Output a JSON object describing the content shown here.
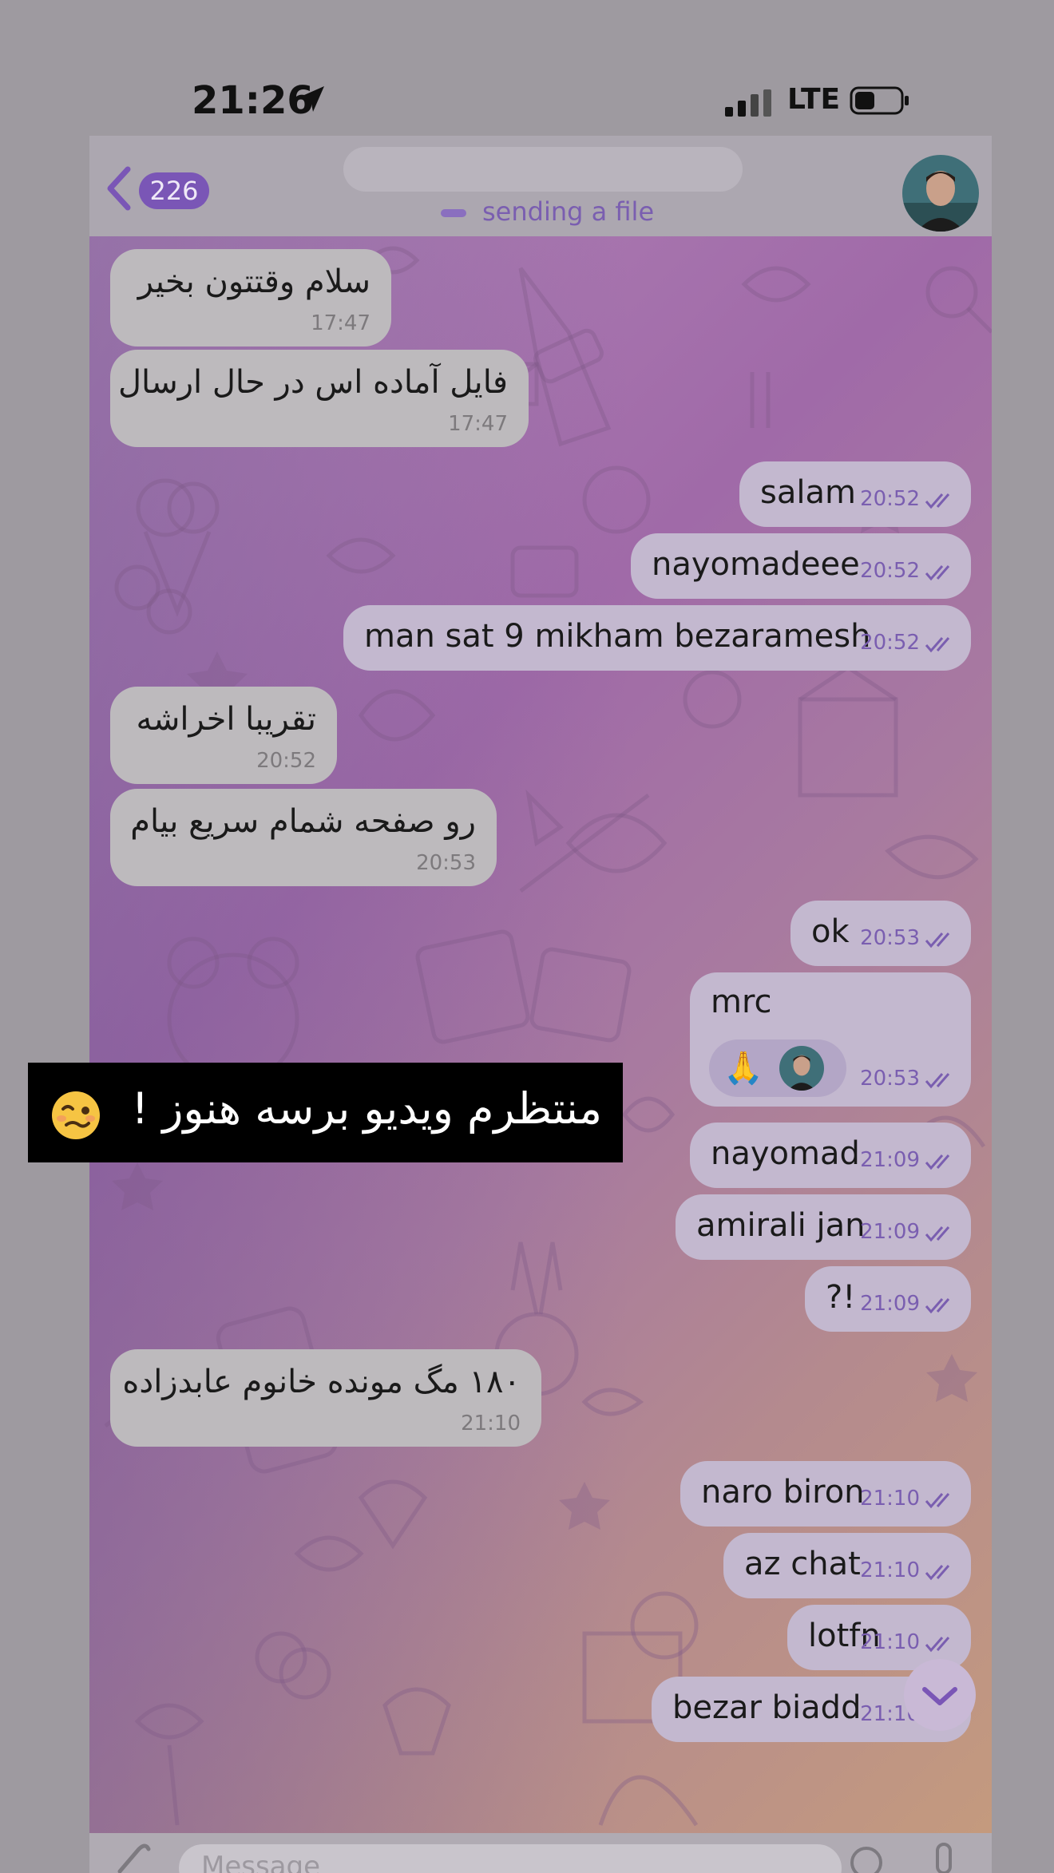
{
  "status_bar": {
    "time": "21:26",
    "network": "LTE"
  },
  "header": {
    "unread_count": "226",
    "typing_status": "sending a file",
    "input_placeholder": "Message"
  },
  "messages": [
    {
      "dir": "in",
      "text": "سلام وقتتون بخیر",
      "time": "17:47"
    },
    {
      "dir": "in",
      "text": "فایل آماده اس در حال ارسال",
      "time": "17:47"
    },
    {
      "dir": "out",
      "text": "salam",
      "time": "20:52"
    },
    {
      "dir": "out",
      "text": "nayomadeee",
      "time": "20:52"
    },
    {
      "dir": "out",
      "text": "man sat 9 mikham bezaramesh",
      "time": "20:52"
    },
    {
      "dir": "in",
      "text": "تقریبا اخراشه",
      "time": "20:52"
    },
    {
      "dir": "in",
      "text": "رو صفحه شمام سریع بیام",
      "time": "20:53"
    },
    {
      "dir": "out",
      "text": "ok",
      "time": "20:53"
    },
    {
      "dir": "out",
      "text": "mrc",
      "time": "20:53",
      "reaction": "🙏"
    },
    {
      "dir": "out",
      "text": "nayomad",
      "time": "21:09"
    },
    {
      "dir": "out",
      "text": "amirali jan",
      "time": "21:09"
    },
    {
      "dir": "out",
      "text": "?!",
      "time": "21:09"
    },
    {
      "dir": "in",
      "text": "۱۸۰ مگ مونده خانوم عابدزاده",
      "time": "21:10"
    },
    {
      "dir": "out",
      "text": "naro biron",
      "time": "21:10"
    },
    {
      "dir": "out",
      "text": "az chat",
      "time": "21:10"
    },
    {
      "dir": "out",
      "text": "lotfn",
      "time": "21:10"
    },
    {
      "dir": "out",
      "text": "bezar biadd",
      "time": "21:10"
    }
  ],
  "overlay": {
    "caption": "منتظرم ویدیو برسه هنوز !"
  },
  "colors": {
    "accent": "#7a56b6",
    "outgoing_bubble": "#c3b8cf",
    "incoming_bubble": "#bdbabd",
    "overlay_bg": "#000000"
  }
}
